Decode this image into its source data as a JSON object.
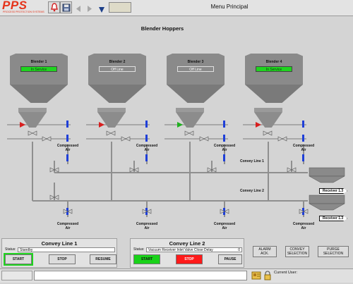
{
  "header": {
    "logo_text": "PPS",
    "logo_tagline": "PROCESS PROTECTION SYSTEMS",
    "title": "Menu Principal",
    "icons": [
      "alarm-bell-icon",
      "save-disk-icon",
      "back-arrow-icon",
      "forward-arrow-icon",
      "dropdown-triangle-icon"
    ]
  },
  "process": {
    "title": "Blender Hoppers",
    "hoppers": [
      {
        "name": "Blender 1",
        "status": "In Service",
        "state": "in"
      },
      {
        "name": "Blender 2",
        "status": "Off Line",
        "state": "off"
      },
      {
        "name": "Blender 3",
        "status": "Off Line",
        "state": "off"
      },
      {
        "name": "Blender 4",
        "status": "In Service",
        "state": "in"
      }
    ],
    "compressed_air_label_line1": "Compressed",
    "compressed_air_label_line2": "Air",
    "convey_line_1_label": "Convey Line 1",
    "convey_line_2_label": "Convey Line 2",
    "receiver_1_label": "Receiver 1.3",
    "receiver_2_label": "Receiver 1.3",
    "colors": {
      "in_service": "#1fd41f",
      "valve_blue": "#1f3fd8",
      "valve_red": "#d81f1f",
      "valve_green": "#1fb01f"
    }
  },
  "convey_line_1": {
    "title": "Convey Line 1",
    "status_label": "Status:",
    "status_value": "Standby",
    "start_label": "START",
    "stop_label": "STOP",
    "resume_label": "RESUME"
  },
  "convey_line_2": {
    "title": "Convey Line 2",
    "status_label": "Status:",
    "status_value": "Vacuum Receiver Inlet Valve Close Delay",
    "status_counter": "0",
    "start_label": "START",
    "stop_label": "STOP",
    "pause_label": "PAUSE"
  },
  "side_buttons": {
    "alarm_ack_line1": "ALARM",
    "alarm_ack_line2": "ACK.",
    "convey_sel_line1": "CONVEY",
    "convey_sel_line2": "SELECTION",
    "purge_sel_line1": "PURGE",
    "purge_sel_line2": "SELECTION"
  },
  "status_bar": {
    "message": "",
    "current_user_label": "Current User:"
  }
}
